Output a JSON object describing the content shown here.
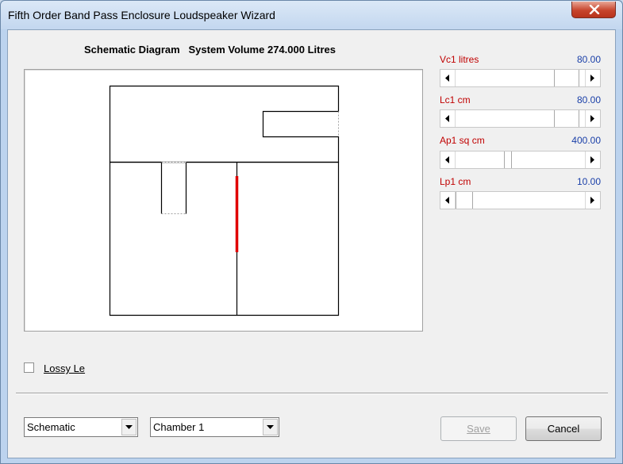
{
  "window": {
    "title": "Fifth Order Band Pass Enclosure Loudspeaker Wizard"
  },
  "schematic": {
    "heading": "Schematic Diagram   System Volume 274.000 Litres"
  },
  "parameters": [
    {
      "label": "Vc1  litres",
      "value": "80.00",
      "position": 0.8
    },
    {
      "label": "Lc1  cm",
      "value": "80.00",
      "position": 0.8
    },
    {
      "label": "Ap1  sq cm",
      "value": "400.00",
      "position": 0.4
    },
    {
      "label": "Lp1  cm",
      "value": "10.00",
      "position": 0.02
    }
  ],
  "options": {
    "lossy_le_label": "Lossy Le",
    "lossy_le_checked": false
  },
  "footer": {
    "view_select": "Schematic",
    "chamber_select": "Chamber 1",
    "save_label": "Save",
    "cancel_label": "Cancel"
  },
  "colors": {
    "param_label": "#c00000",
    "param_value": "#1a3fa8",
    "driver": "#e00000"
  }
}
